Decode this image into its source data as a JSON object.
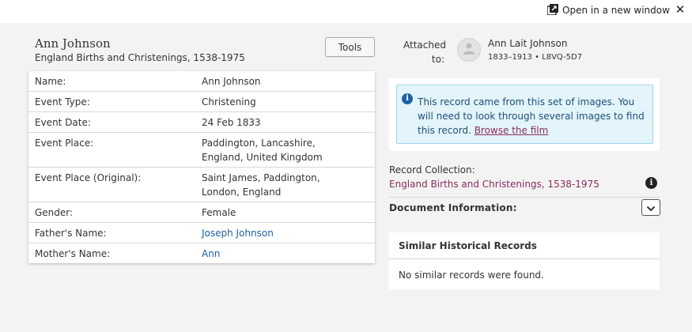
{
  "topbar": {
    "open_new_window": "Open in a new window"
  },
  "header": {
    "name": "Ann Johnson",
    "collection": "England Births and Christenings, 1538-1975",
    "tools_label": "Tools"
  },
  "record": {
    "rows": [
      {
        "label": "Name:",
        "value": "Ann Johnson"
      },
      {
        "label": "Event Type:",
        "value": "Christening"
      },
      {
        "label": "Event Date:",
        "value": "24 Feb 1833"
      },
      {
        "label": "Event Place:",
        "value": "Paddington, Lancashire, England, United Kingdom"
      },
      {
        "label": "Event Place (Original):",
        "value": "Saint James, Paddington, London, England"
      },
      {
        "label": "Gender:",
        "value": "Female"
      },
      {
        "label": "Father's Name:",
        "value": "Joseph Johnson"
      },
      {
        "label": "Mother's Name:",
        "value": "Ann"
      }
    ]
  },
  "attached": {
    "label": "Attached to:",
    "person_name": "Ann Lait Johnson",
    "meta": "1833–1913 • L8VQ-5D7"
  },
  "info": {
    "text": "This record came from this set of images. You will need to look through several images to find this record.",
    "browse_link": "Browse the film"
  },
  "record_collection": {
    "label": "Record Collection:",
    "link": "England Births and Christenings, 1538-1975"
  },
  "document_information": {
    "label": "Document Information:"
  },
  "similar": {
    "title": "Similar Historical Records",
    "empty": "No similar records were found."
  },
  "colors": {
    "link_blue": "#1f5fa8",
    "link_maroon": "#8c2b5e",
    "info_bg": "#e3f4fa",
    "info_border": "#9fd3e8"
  },
  "icons": [
    "open-new-window-icon",
    "close-icon",
    "avatar-icon",
    "info-icon",
    "chevron-down-icon"
  ]
}
